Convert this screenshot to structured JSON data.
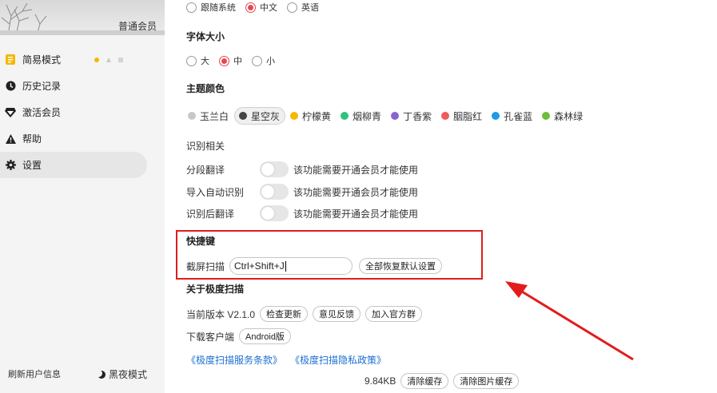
{
  "sidebar": {
    "member_label": "普通会员",
    "items": [
      {
        "label": "简易模式",
        "icon": "document-icon"
      },
      {
        "label": "历史记录",
        "icon": "clock-icon"
      },
      {
        "label": "激活会员",
        "icon": "diamond-icon"
      },
      {
        "label": "帮助",
        "icon": "warning-icon"
      },
      {
        "label": "设置",
        "icon": "gear-icon"
      }
    ],
    "refresh_label": "刷新用户信息",
    "dark_mode_label": "黑夜模式"
  },
  "settings": {
    "language": {
      "options": [
        "跟随系统",
        "中文",
        "英语"
      ],
      "selected": "中文"
    },
    "font_size": {
      "title": "字体大小",
      "options": [
        "大",
        "中",
        "小"
      ],
      "selected": "中"
    },
    "theme": {
      "title": "主题颜色",
      "options": [
        {
          "label": "玉兰白",
          "color": "#c8c8c8"
        },
        {
          "label": "星空灰",
          "color": "#444444"
        },
        {
          "label": "柠檬黄",
          "color": "#f5b800"
        },
        {
          "label": "烟柳青",
          "color": "#2ec27e"
        },
        {
          "label": "丁香紫",
          "color": "#8a63d2"
        },
        {
          "label": "胭脂红",
          "color": "#f05b5b"
        },
        {
          "label": "孔雀蓝",
          "color": "#1e9be8"
        },
        {
          "label": "森林绿",
          "color": "#6cbf3a"
        }
      ],
      "selected": "星空灰"
    },
    "recognition": {
      "title": "识别相关",
      "toggles": [
        {
          "label": "分段翻译",
          "desc": "该功能需要开通会员才能使用",
          "on": false
        },
        {
          "label": "导入自动识别",
          "desc": "该功能需要开通会员才能使用",
          "on": false
        },
        {
          "label": "识别后翻译",
          "desc": "该功能需要开通会员才能使用",
          "on": false
        }
      ]
    },
    "hotkeys": {
      "title": "快捷键",
      "screenshot_label": "截屏扫描",
      "screenshot_value": "Ctrl+Shift+J",
      "reset_label": "全部恢复默认设置"
    },
    "about": {
      "title": "关于极度扫描",
      "version_label": "当前版本 V2.1.0",
      "check_update": "检查更新",
      "feedback": "意见反馈",
      "join_group": "加入官方群",
      "download_label": "下载客户端",
      "android": "Android版",
      "terms_link": "《极度扫描服务条款》",
      "privacy_link": "《极度扫描隐私政策》",
      "cache_size": "9.84KB",
      "clear_cache": "清除缓存",
      "clear_image_cache": "清除图片缓存"
    }
  },
  "colors": {
    "accent": "#e8474f",
    "annotation_red": "#e21c1c",
    "link": "#1a6fd1"
  }
}
